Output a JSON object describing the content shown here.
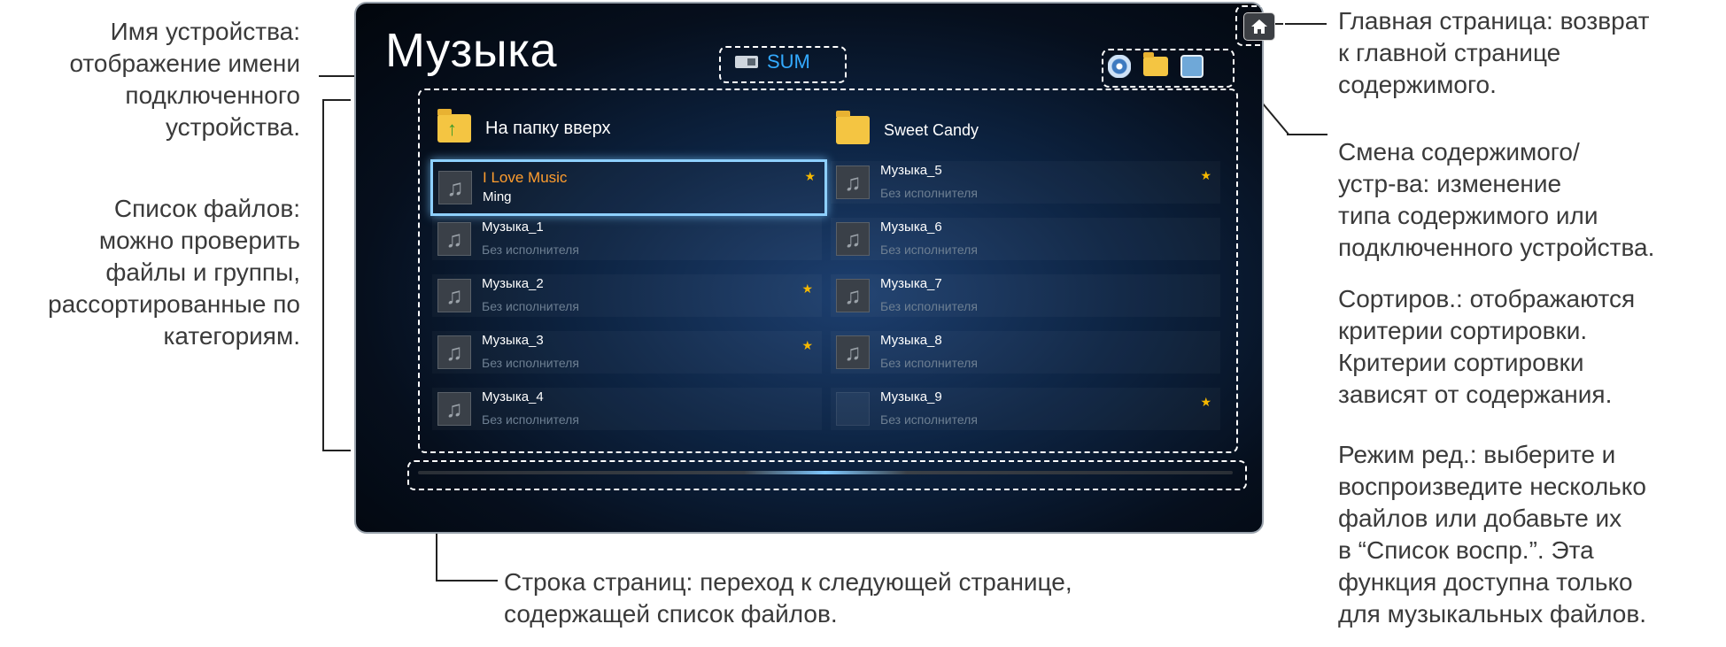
{
  "screen": {
    "title": "Музыка",
    "device_name": "SUM",
    "icons": [
      "home-icon",
      "disc-icon",
      "folder-icon",
      "edit-icon"
    ],
    "folders": [
      {
        "label": "На папку вверх",
        "icon": "folder-up-icon"
      },
      {
        "label": "Sweet Candy",
        "icon": "folder-icon"
      }
    ],
    "left_items": [
      {
        "title": "I Love Music",
        "artist": "Ming",
        "starred": true,
        "selected": true
      },
      {
        "title": "Музыка_1",
        "artist": "Без исполнителя",
        "starred": false
      },
      {
        "title": "Музыка_2",
        "artist": "Без исполнителя",
        "starred": true
      },
      {
        "title": "Музыка_3",
        "artist": "Без исполнителя",
        "starred": true
      },
      {
        "title": "Музыка_4",
        "artist": "Без исполнителя",
        "starred": false
      }
    ],
    "right_items": [
      {
        "title": "Музыка_5",
        "artist": "Без исполнителя",
        "starred": true
      },
      {
        "title": "Музыка_6",
        "artist": "Без исполнителя",
        "starred": false
      },
      {
        "title": "Музыка_7",
        "artist": "Без исполнителя",
        "starred": false
      },
      {
        "title": "Музыка_8",
        "artist": "Без исполнителя",
        "starred": false
      },
      {
        "title": "Музыка_9",
        "artist": "Без исполнителя",
        "starred": true,
        "no_thumb": true
      }
    ],
    "star_symbol": "★"
  },
  "annotations": {
    "device_name": [
      "Имя устройства:",
      "отображение имени",
      "подключенного",
      "устройства."
    ],
    "file_list": [
      "Список файлов:",
      "можно проверить",
      "файлы и группы,",
      "рассортированные по",
      "категориям."
    ],
    "home": [
      "Главная страница: возврат",
      "к главной странице",
      "содержимого."
    ],
    "content_change": [
      "Смена содержимого/",
      "устр-ва: изменение",
      "типа содержимого или",
      "подключенного устройства."
    ],
    "sort": [
      "Сортиров.: отображаются",
      "критерии сортировки.",
      "Критерии сортировки",
      "зависят от содержания."
    ],
    "edit_mode": [
      "Режим ред.: выберите и",
      "воспроизведите несколько",
      "файлов или добавьте их",
      "в “Список воспр.”. Эта",
      "функция доступна только",
      "для музыкальных файлов."
    ],
    "page_bar": [
      "Строка страниц: переход к следующей странице,",
      "содержащей список файлов."
    ]
  }
}
